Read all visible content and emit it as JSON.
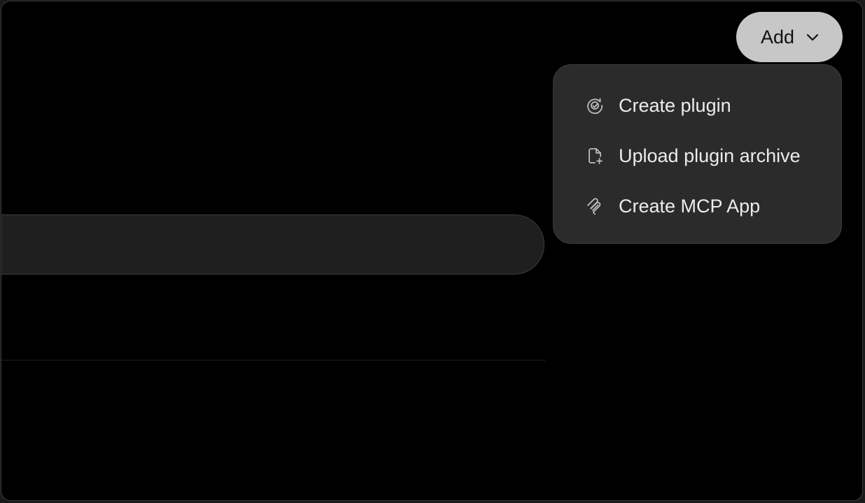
{
  "add_button": {
    "label": "Add",
    "icon": "chevron-down-icon"
  },
  "menu": {
    "items": [
      {
        "label": "Create plugin",
        "icon": "plugin-icon"
      },
      {
        "label": "Upload plugin archive",
        "icon": "file-upload-icon"
      },
      {
        "label": "Create MCP App",
        "icon": "mcp-icon"
      }
    ]
  },
  "colors": {
    "background": "#000000",
    "button_bg": "#c7c7c7",
    "menu_bg": "#2b2b2b",
    "menu_text": "#ececec",
    "search_bg": "#1f1f1f"
  }
}
